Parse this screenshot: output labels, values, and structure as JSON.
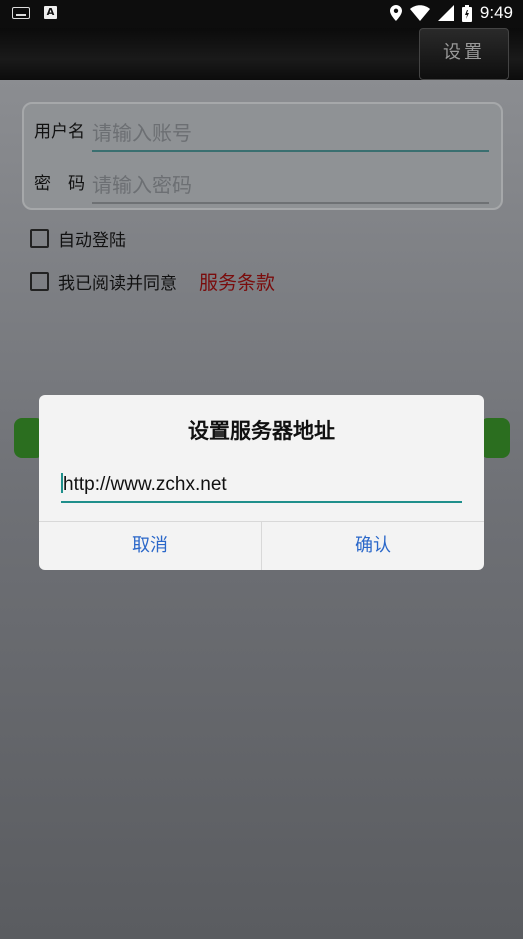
{
  "status_bar": {
    "time": "9:49"
  },
  "toolbar": {
    "settings_label": "设置"
  },
  "login_form": {
    "username_label": "用户名",
    "username_placeholder": "请输入账号",
    "password_label": "密　码",
    "password_placeholder": "请输入密码"
  },
  "options": {
    "auto_login_label": "自动登陆",
    "agree_label": "我已阅读并同意",
    "terms_link": "服务条款"
  },
  "dialog": {
    "title": "设置服务器地址",
    "server_url": "http://www.zchx.net",
    "cancel_label": "取消",
    "confirm_label": "确认"
  },
  "colors": {
    "accent": "#1f8f8b",
    "dialog_button": "#2a67c9",
    "terms_link": "#7a0c0c",
    "login_button": "#2b6e1f"
  },
  "icons": [
    "keyboard-icon",
    "text-a-icon",
    "location-icon",
    "wifi-icon",
    "signal-icon",
    "battery-icon"
  ]
}
